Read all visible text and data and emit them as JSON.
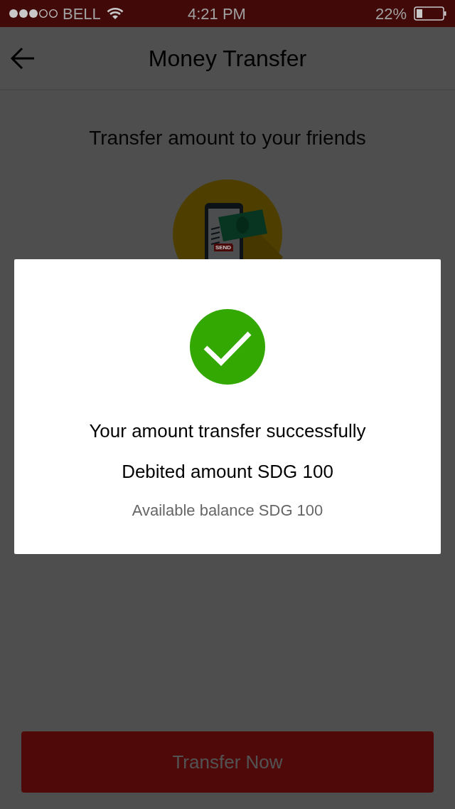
{
  "status_bar": {
    "carrier": "BELL",
    "time": "4:21 PM",
    "battery": "22%"
  },
  "header": {
    "title": "Money Transfer"
  },
  "heading": "Transfer amount to your friends",
  "illustration": {
    "label": "SEND"
  },
  "dialog": {
    "message": "Your amount transfer successfully",
    "debited": "Debited amount SDG 100",
    "balance": "Available balance SDG 100"
  },
  "button": "Transfer Now"
}
